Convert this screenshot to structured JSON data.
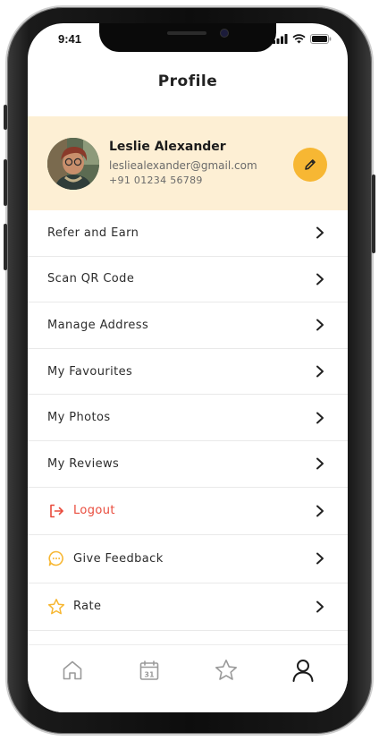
{
  "status_bar": {
    "time": "9:41"
  },
  "header": {
    "title": "Profile"
  },
  "profile": {
    "name": "Leslie Alexander",
    "email": "lesliealexander@gmail.com",
    "phone": "+91 01234 56789"
  },
  "menu": {
    "items": [
      {
        "label": "Refer and Earn"
      },
      {
        "label": "Scan QR Code"
      },
      {
        "label": "Manage Address"
      },
      {
        "label": "My Favourites"
      },
      {
        "label": "My Photos"
      },
      {
        "label": "My Reviews"
      },
      {
        "label": "Logout",
        "icon": "logout-icon"
      },
      {
        "label": "Give Feedback",
        "icon": "chat-bubble-icon"
      },
      {
        "label": "Rate",
        "icon": "star-icon"
      }
    ]
  },
  "tabbar": {
    "tabs": [
      {
        "icon": "home-icon",
        "active": false
      },
      {
        "icon": "calendar-icon",
        "label": "31",
        "active": false
      },
      {
        "icon": "star-icon",
        "active": false
      },
      {
        "icon": "user-icon",
        "active": true
      }
    ]
  },
  "colors": {
    "accent": "#f7b733",
    "profile_bg": "#fdefd4",
    "logout_red": "#e94b3c",
    "inactive_icon": "#9a9a9a"
  }
}
